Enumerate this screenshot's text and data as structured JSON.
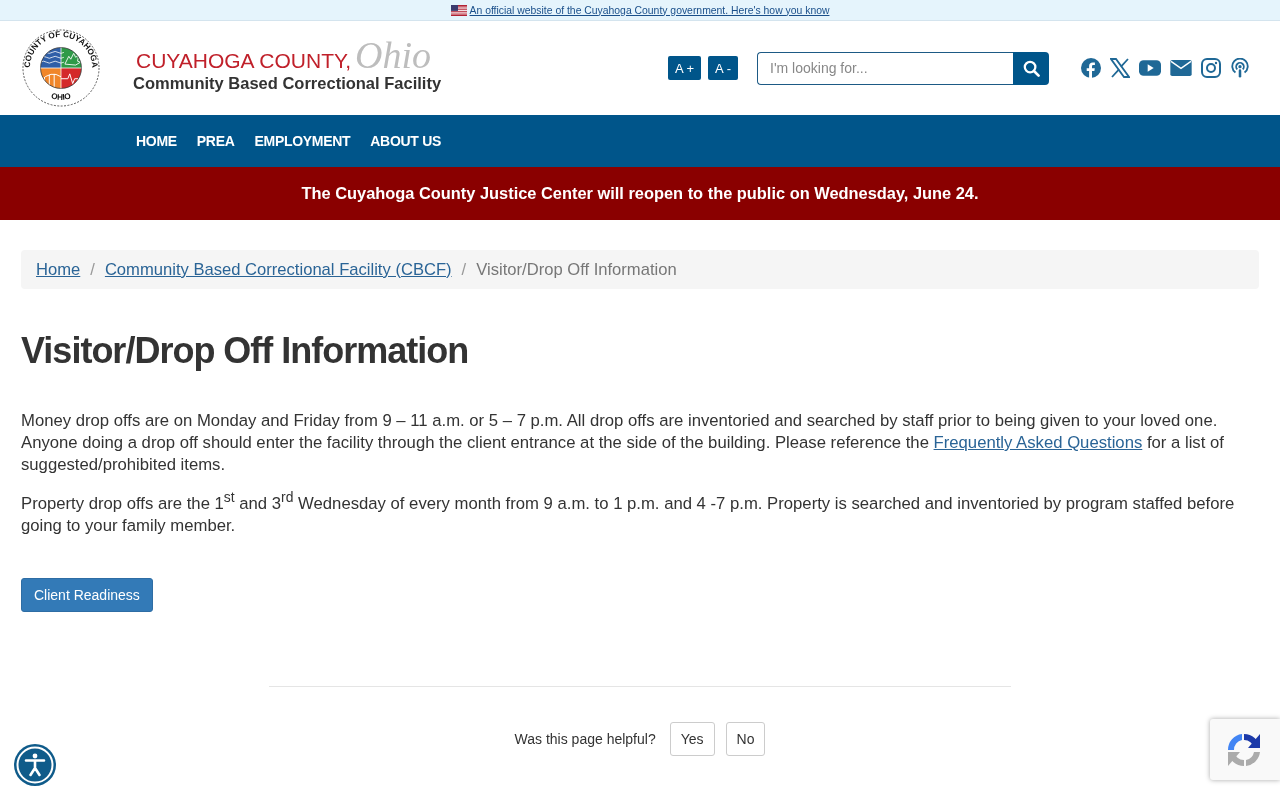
{
  "gov_banner": {
    "text": "An official website of the Cuyahoga County government. Here's how you know"
  },
  "header": {
    "logo": {
      "ring_text": "COUNTY OF CUYAHOGA",
      "bottom_text": "OHIO"
    },
    "title": "CUYAHOGA COUNTY,",
    "title_script": "Ohio",
    "subtitle": "Community Based Correctional Facility",
    "font_buttons": [
      "A +",
      "A -"
    ],
    "search": {
      "placeholder": "I'm looking for..."
    }
  },
  "nav": [
    "HOME",
    "PREA",
    "EMPLOYMENT",
    "ABOUT US"
  ],
  "alert": {
    "text": "The Cuyahoga County Justice Center will reopen to the public on Wednesday, June 24."
  },
  "breadcrumb": {
    "separator": "/",
    "items": [
      {
        "label": "Home",
        "kind": "link"
      },
      {
        "label": "Community Based Correctional Facility (CBCF)",
        "kind": "link"
      },
      {
        "label": "Visitor/Drop Off Information",
        "kind": "current"
      }
    ]
  },
  "page_title": "Visitor/Drop Off Information",
  "paragraphs": [
    [
      {
        "kind": "text",
        "text": "Money drop offs are on Monday and Friday from 9 – 11 a.m. or 5 – 7 p.m. All drop offs are inventoried and searched by staff prior to being given to your loved one. Anyone doing a drop off should enter the facility through the client entrance at the side of the building. Please reference the "
      },
      {
        "kind": "link",
        "text": "Frequently Asked Questions"
      },
      {
        "kind": "text",
        "text": " for a list of suggested/prohibited items."
      }
    ],
    [
      {
        "kind": "text",
        "text": "Property drop offs are the 1$^{st}$ and 3$^{rd}$ Wednesday of every month from 9 a.m. to 1 p.m. and 4 -7 p.m. Property is searched and inventoried by program staffed before going to your family member."
      }
    ]
  ],
  "action_button": "Client Readiness",
  "feedback": {
    "question": "Was this page helpful?",
    "options": [
      "Yes",
      "No"
    ]
  }
}
